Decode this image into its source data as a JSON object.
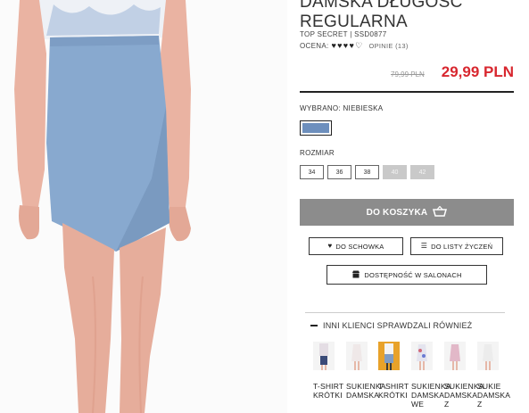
{
  "product": {
    "title": "DAMSKA DŁUGOŚĆ REGULARNA",
    "meta": "TOP SECRET | SSD0877",
    "rating_label": "OCENA:",
    "rating_value": 4,
    "rating_max": 5,
    "reviews": "OPINIE (13)",
    "old_price": "79,99 PLN",
    "price": "29,99 PLN",
    "price_color": "#d8272f"
  },
  "color": {
    "label": "WYBRANO: NIEBIESKA",
    "swatch": "#6d8fbd"
  },
  "size": {
    "label": "ROZMIAR",
    "options": [
      {
        "value": "34",
        "available": true
      },
      {
        "value": "36",
        "available": true
      },
      {
        "value": "38",
        "available": true
      },
      {
        "value": "40",
        "available": false
      },
      {
        "value": "42",
        "available": false
      }
    ]
  },
  "actions": {
    "cart": "DO KOSZYKA",
    "stash": "DO SCHOWKA",
    "wishlist": "DO LISTY ŻYCZEŃ",
    "stores": "DOSTĘPNOŚĆ W SALONACH"
  },
  "also": {
    "heading": "INNI KLIENCI SPRAWDZALI RÓWNIEŻ",
    "items": [
      {
        "name": "T-SHIRT KRÓTKI",
        "color": "#e8e0e6"
      },
      {
        "name": "SUKIENKA DAMSKA",
        "color": "#f0eaea"
      },
      {
        "name": "T-SHIRT KRÓTKI",
        "color": "#e5a22a"
      },
      {
        "name": "SUKIENKA DAMSKA WE",
        "color": "#e6e6ee"
      },
      {
        "name": "SUKIENKA DAMSKA Z",
        "color": "#e2b8c8"
      },
      {
        "name": "SUKIE DAMSKA Z",
        "color": "#ececec"
      }
    ]
  }
}
